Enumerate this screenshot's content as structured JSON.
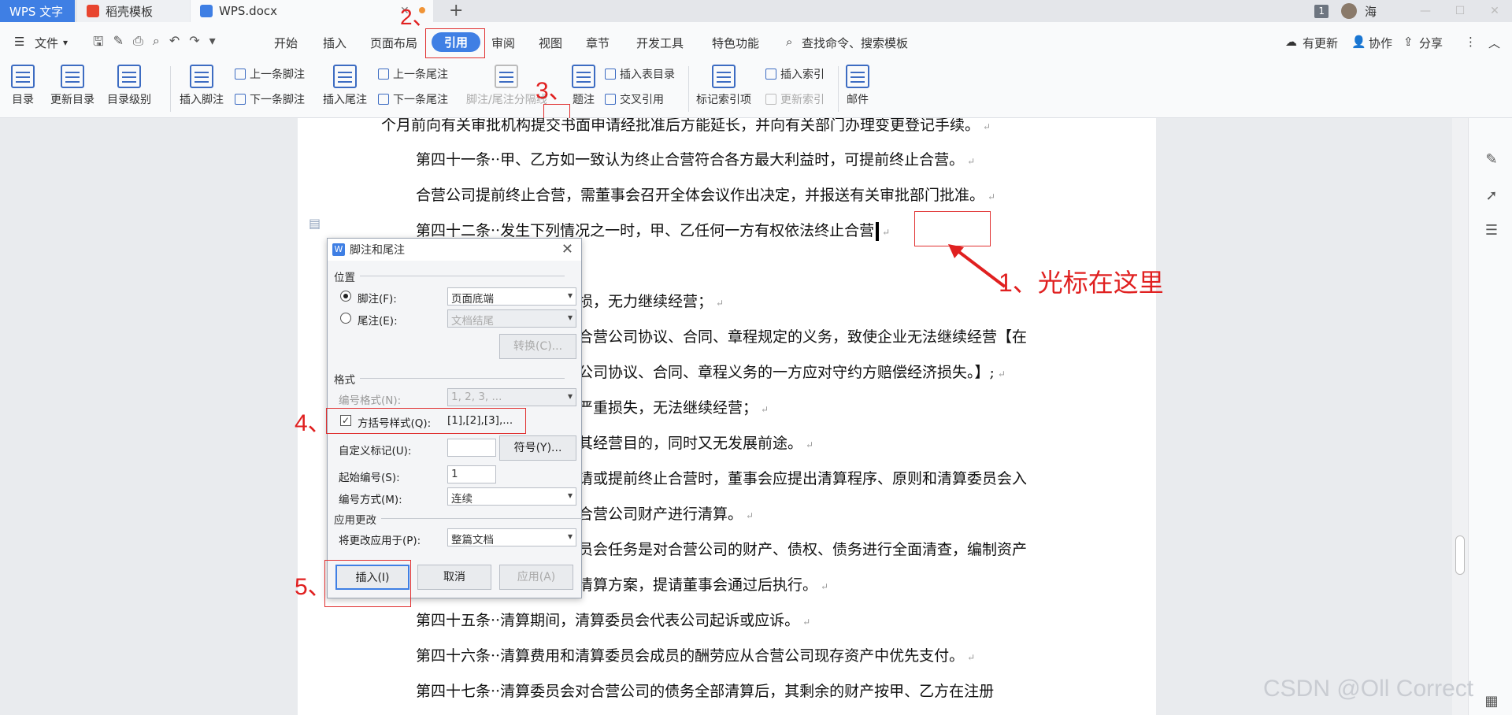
{
  "tabs": [
    {
      "label": "WPS 文字"
    },
    {
      "label": "稻壳模板"
    },
    {
      "label": "WPS.docx"
    }
  ],
  "window": {
    "page_badge": "1",
    "user": "海"
  },
  "menu": {
    "file": "文件",
    "items": [
      "开始",
      "插入",
      "页面布局",
      "引用",
      "审阅",
      "视图",
      "章节",
      "开发工具",
      "特色功能"
    ],
    "search": "查找命令、搜索模板",
    "update": "有更新",
    "collab": "协作",
    "share": "分享"
  },
  "ribbon": {
    "toc": "目录",
    "update_toc": "更新目录",
    "toc_level": "目录级别",
    "insert_footnote": "插入脚注",
    "prev_footnote": "上一条脚注",
    "next_footnote": "下一条脚注",
    "insert_endnote": "插入尾注",
    "prev_endnote": "上一条尾注",
    "next_endnote": "下一条尾注",
    "separator": "脚注/尾注分隔线",
    "caption": "题注",
    "insert_table_toc": "插入表目录",
    "cross_ref": "交叉引用",
    "mark_index": "标记索引项",
    "insert_index": "插入索引",
    "update_index": "更新索引",
    "mail": "邮件"
  },
  "doc": {
    "lines": [
      "个月前向有关审批机构提交书面申请经批准后方能延长，并向有关部门办理变更登记手续。",
      "第四十一条··甲、乙方如一致认为终止合营符合各方最大利益时，可提前终止合营。",
      "合营公司提前终止合营，需董事会召开全体会议作出决定，并报送有关审批部门批准。",
      "第四十二条··发生下列情况之一时，甲、乙任何一方有权依法终止合营",
      "损，无力继续经营；",
      "合营公司协议、合同、章程规定的义务，致使企业无法继续经营【在",
      "公司协议、合同、章程义务的一方应对守约方赔偿经济损失。】;",
      "严重损失，无法继续经营；",
      "其经营目的，同时又无发展前途。",
      "请或提前终止合营时，董事会应提出清算程序、原则和清算委员会入",
      "合营公司财产进行清算。",
      "员会任务是对合营公司的财产、债权、债务进行全面清查，编制资产",
      "清算方案，提请董事会通过后执行。",
      "第四十五条··清算期间，清算委员会代表公司起诉或应诉。",
      "第四十六条··清算费用和清算委员会成员的酬劳应从合营公司现存资产中优先支付。",
      "第四十七条··清算委员会对合营公司的债务全部清算后，其剩余的财产按甲、乙方在注册"
    ]
  },
  "dialog": {
    "title": "脚注和尾注",
    "position": "位置",
    "footnote": "脚注(F):",
    "footnote_val": "页面底端",
    "endnote": "尾注(E):",
    "endnote_val": "文档结尾",
    "convert": "转换(C)...",
    "format": "格式",
    "num_format": "编号格式(N):",
    "num_format_val": "1, 2, 3, ...",
    "bracket": "方括号样式(Q):",
    "bracket_val": "[1],[2],[3],...",
    "custom": "自定义标记(U):",
    "symbol": "符号(Y)...",
    "start": "起始编号(S):",
    "start_val": "1",
    "numbering": "编号方式(M):",
    "numbering_val": "连续",
    "apply_section": "应用更改",
    "apply_to": "将更改应用于(P):",
    "apply_to_val": "整篇文档",
    "insert": "插入(I)",
    "cancel": "取消",
    "apply": "应用(A)"
  },
  "annotations": {
    "a1": "1、光标在这里",
    "a2": "2、",
    "a3": "3、",
    "a4": "4、",
    "a5": "5、"
  },
  "watermark": "CSDN @Oll Correct"
}
